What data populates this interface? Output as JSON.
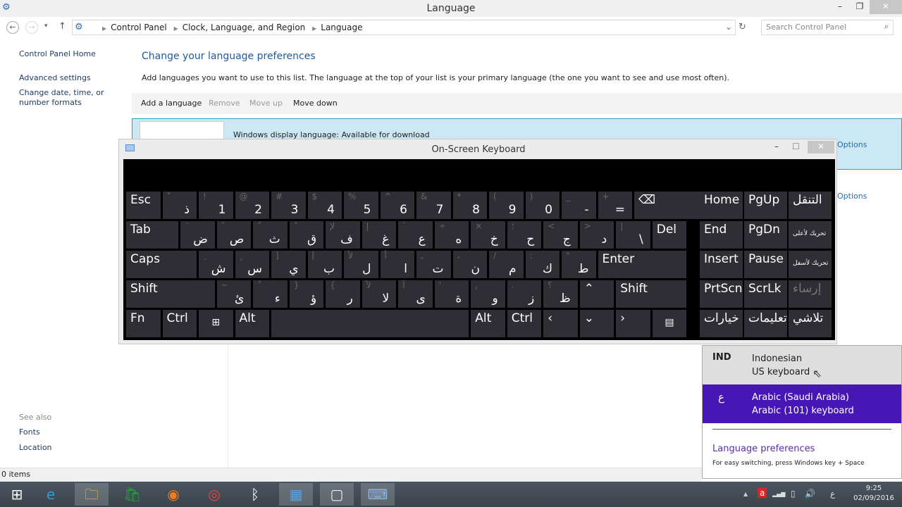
{
  "window": {
    "title": "Language",
    "minimize": "–",
    "restore": "❐",
    "close": "✕"
  },
  "nav": {
    "back": "←",
    "forward": "→",
    "recent": "▾",
    "up": "↑",
    "breadcrumbs": [
      "Control Panel",
      "Clock, Language, and Region",
      "Language"
    ],
    "dropdown": "⌄",
    "refresh": "↻",
    "search_placeholder": "Search Control Panel",
    "search_icon": "⌕"
  },
  "sidebar": {
    "items": [
      "Control Panel Home",
      "Advanced settings",
      "Change date, time, or number formats"
    ],
    "see_also_label": "See also",
    "see_also": [
      "Fonts",
      "Location"
    ]
  },
  "main": {
    "heading": "Change your language preferences",
    "description": "Add languages you want to use to this list. The language at the top of your list is your primary language (the one you want to see and use most often).",
    "toolbar": {
      "add": "Add a language",
      "remove": "Remove",
      "move_up": "Move up",
      "move_down": "Move down"
    },
    "languages": [
      {
        "status": "Windows display language: Available for download",
        "options": "Options"
      },
      {
        "status": "",
        "options": "Options"
      }
    ]
  },
  "status_bar": {
    "items": "0 items"
  },
  "osk": {
    "title": "On-Screen Keyboard",
    "minimize": "–",
    "maximize": "☐",
    "close": "✕",
    "rows": [
      [
        {
          "main": "Esc",
          "w": 1
        },
        {
          "shift": "ّ",
          "ar": "ذ"
        },
        {
          "shift": "!",
          "main": "1",
          "num": true
        },
        {
          "shift": "@",
          "main": "2",
          "num": true
        },
        {
          "shift": "#",
          "main": "3",
          "num": true
        },
        {
          "shift": "$",
          "main": "4",
          "num": true
        },
        {
          "shift": "%",
          "main": "5",
          "num": true
        },
        {
          "shift": "^",
          "main": "6",
          "num": true
        },
        {
          "shift": "&",
          "main": "7",
          "num": true
        },
        {
          "shift": "*",
          "main": "8",
          "num": true
        },
        {
          "shift": "(",
          "main": "9",
          "num": true
        },
        {
          "shift": ")",
          "main": "0",
          "num": true
        },
        {
          "shift": "_",
          "main": "-",
          "num": true
        },
        {
          "shift": "+",
          "main": "=",
          "num": true
        },
        {
          "main": "⌫",
          "w": 2
        }
      ],
      [
        {
          "main": "Tab",
          "w": 1.5
        },
        {
          "shift": "َ",
          "ar": "ض"
        },
        {
          "shift": "ً",
          "ar": "ص"
        },
        {
          "shift": "ُ",
          "ar": "ث"
        },
        {
          "shift": "ٌ",
          "ar": "ق"
        },
        {
          "shift": "لإ",
          "ar": "ف"
        },
        {
          "shift": "إ",
          "ar": "غ"
        },
        {
          "shift": "`",
          "ar": "ع"
        },
        {
          "shift": "÷",
          "ar": "ه"
        },
        {
          "shift": "×",
          "ar": "خ"
        },
        {
          "shift": "؛",
          "ar": "ح"
        },
        {
          "shift": "<",
          "ar": "ج"
        },
        {
          "shift": ">",
          "ar": "د"
        },
        {
          "shift": "|",
          "ar": "\\"
        },
        {
          "main": "Del",
          "w": 1
        }
      ],
      [
        {
          "main": "Caps",
          "w": 2
        },
        {
          "shift": "ِ",
          "ar": "ش"
        },
        {
          "shift": "ٍ",
          "ar": "س"
        },
        {
          "shift": "]",
          "ar": "ي"
        },
        {
          "shift": "[",
          "ar": "ب"
        },
        {
          "shift": "لأ",
          "ar": "ل"
        },
        {
          "shift": "أ",
          "ar": "ا"
        },
        {
          "shift": "ـ",
          "ar": "ت"
        },
        {
          "shift": "،",
          "ar": "ن"
        },
        {
          "shift": "/",
          "ar": "م"
        },
        {
          "shift": ":",
          "ar": "ك"
        },
        {
          "shift": "\"",
          "ar": "ط"
        },
        {
          "main": "Enter",
          "w": 2.5
        }
      ],
      [
        {
          "main": "Shift",
          "w": 2.5
        },
        {
          "shift": "~",
          "ar": "ئ"
        },
        {
          "shift": "ْ",
          "ar": "ء"
        },
        {
          "shift": "}",
          "ar": "ؤ"
        },
        {
          "shift": "{",
          "ar": "ر"
        },
        {
          "shift": "لآ",
          "ar": "لا"
        },
        {
          "shift": "آ",
          "ar": "ى"
        },
        {
          "shift": "'",
          "ar": "ة"
        },
        {
          "shift": ",",
          "ar": "و"
        },
        {
          "shift": ".",
          "ar": "ز"
        },
        {
          "shift": "؟",
          "ar": "ظ"
        },
        {
          "main": "⌃",
          "w": 1
        },
        {
          "main": "Shift",
          "w": 2
        }
      ],
      [
        {
          "main": "Fn",
          "w": 1
        },
        {
          "main": "Ctrl",
          "w": 1
        },
        {
          "main": "⊞",
          "w": 1,
          "icon": "windows"
        },
        {
          "main": "Alt",
          "w": 1
        },
        {
          "main": "",
          "w": 5.5,
          "space": true
        },
        {
          "main": "Alt",
          "w": 1
        },
        {
          "main": "Ctrl",
          "w": 1
        },
        {
          "main": "‹",
          "w": 1
        },
        {
          "main": "⌄",
          "w": 1
        },
        {
          "main": "›",
          "w": 1
        },
        {
          "main": "▤",
          "w": 1,
          "icon": "menu"
        }
      ]
    ],
    "side": [
      [
        "Home",
        "PgUp",
        "التنقل"
      ],
      [
        "End",
        "PgDn",
        "تحريك لأعلى"
      ],
      [
        "Insert",
        "Pause",
        "تحريك لأسفل"
      ],
      [
        "PrtScn",
        "ScrLk",
        "إرساء"
      ],
      [
        "خيارات",
        "تعليمات",
        "تلاشي"
      ]
    ]
  },
  "language_flyout": {
    "items": [
      {
        "code": "IND",
        "language": "Indonesian",
        "keyboard": "US keyboard"
      },
      {
        "code": "ع",
        "language": "Arabic (Saudi Arabia)",
        "keyboard": "Arabic (101) keyboard",
        "selected": true
      }
    ],
    "preferences_link": "Language preferences",
    "hint": "For easy switching, press Windows key + Space",
    "selected_color": "#4617b4"
  },
  "taskbar": {
    "apps": [
      {
        "name": "start",
        "glyph": "⊞"
      },
      {
        "name": "internet-explorer",
        "glyph": "e"
      },
      {
        "name": "file-explorer",
        "glyph": "🗀"
      },
      {
        "name": "store",
        "glyph": "🛍"
      },
      {
        "name": "firefox",
        "glyph": "◉"
      },
      {
        "name": "chrome",
        "glyph": "◎"
      },
      {
        "name": "bluetooth",
        "glyph": "ᛒ"
      },
      {
        "name": "control-panel",
        "glyph": "▦"
      },
      {
        "name": "window-app",
        "glyph": "▢"
      },
      {
        "name": "on-screen-keyboard",
        "glyph": "⌨"
      }
    ],
    "tray": {
      "up_arrow": "▲",
      "antivirus": "a",
      "signal": "▂▄▆",
      "battery": "▯",
      "volume": "🔊",
      "ime": "ع",
      "time": "9:25",
      "date": "02/09/2016"
    }
  }
}
